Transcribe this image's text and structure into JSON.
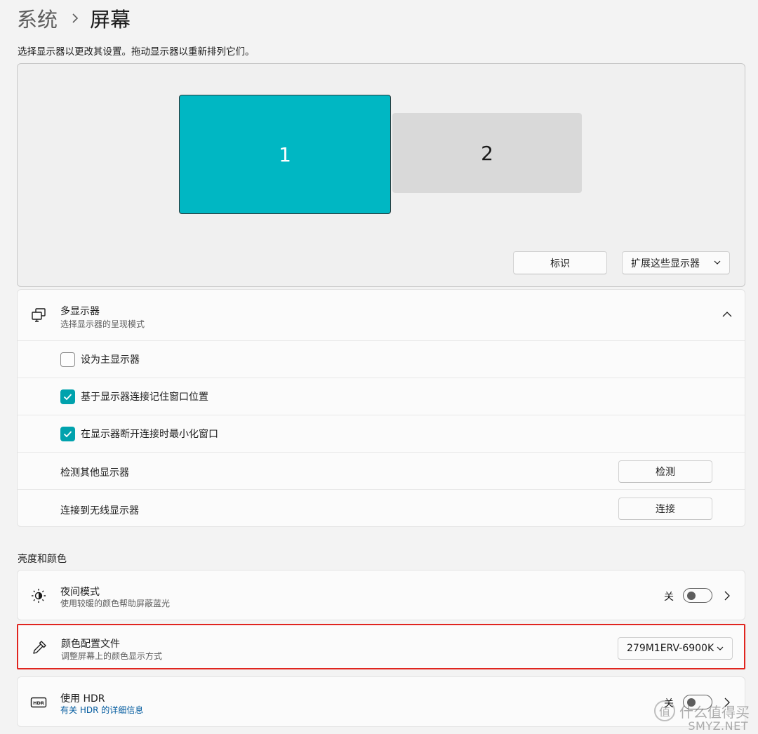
{
  "breadcrumb": {
    "parent": "系统",
    "separator": "›",
    "current": "屏幕"
  },
  "description": "选择显示器以更改其设置。拖动显示器以重新排列它们。",
  "arrangement": {
    "monitors": [
      {
        "label": "1",
        "selected": true
      },
      {
        "label": "2",
        "selected": false
      }
    ],
    "identify_label": "标识",
    "extend_label": "扩展这些显示器",
    "accent": "#00b7c3"
  },
  "multi_display": {
    "title": "多显示器",
    "subtitle": "选择显示器的呈现模式",
    "expanded": true,
    "options": [
      {
        "label": "设为主显示器",
        "checked": false
      },
      {
        "label": "基于显示器连接记住窗口位置",
        "checked": true
      },
      {
        "label": "在显示器断开连接时最小化窗口",
        "checked": true
      }
    ],
    "detect": {
      "label": "检测其他显示器",
      "button": "检测"
    },
    "wireless": {
      "label": "连接到无线显示器",
      "button": "连接"
    }
  },
  "brightness_section": {
    "heading": "亮度和颜色",
    "night_light": {
      "title": "夜间模式",
      "subtitle": "使用较暖的颜色帮助屏蔽蓝光",
      "state": "关",
      "on": false
    },
    "color_profile": {
      "title": "颜色配置文件",
      "subtitle": "调整屏幕上的颜色显示方式",
      "value": "279M1ERV-6900K",
      "highlight_color": "#e0251f"
    },
    "hdr": {
      "title": "使用 HDR",
      "link": "有关 HDR 的详细信息",
      "state": "关",
      "on": false,
      "icon_text": "HDR"
    }
  },
  "watermark": {
    "badge": "值",
    "text": "什么值得买",
    "site": "SMYZ.NET"
  }
}
